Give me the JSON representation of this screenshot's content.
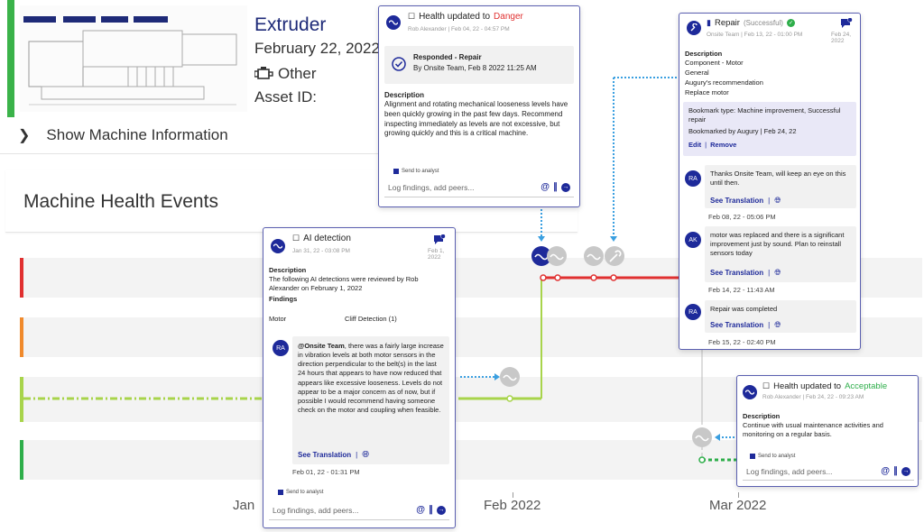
{
  "machine": {
    "name": "Extruder",
    "date": "February 22, 2022",
    "type": "Other",
    "asset_label": "Asset ID:",
    "show_info": "Show Machine Information"
  },
  "events": {
    "title": "Machine Health Events"
  },
  "timeline": {
    "labels": [
      "Jan",
      "Feb 2022",
      "Mar 2022"
    ]
  },
  "colors": {
    "danger": "#e03030",
    "acceptable": "#2eae4a",
    "warning": "#f08a2c",
    "caution": "#a8d44b",
    "brand": "#1e2a9a"
  },
  "popup_danger": {
    "title_prefix": "Health updated to",
    "status": "Danger",
    "meta": "Rob Alexander | Feb 04, 22 - 04:57 PM",
    "responded_title": "Responded - Repair",
    "responded_by": "By Onsite Team, Feb 8 2022 11:25 AM",
    "desc_label": "Description",
    "desc": "Alignment and rotating mechanical looseness levels have been quickly growing in the past few days. Recommend inspecting immediately as levels are not excessive, but growing quickly and this is a critical machine.",
    "send": "Send to analyst",
    "log_placeholder": "Log findings, add peers..."
  },
  "popup_ai": {
    "title": "AI detection",
    "meta": "Jan 31, 22 - 03:08 PM",
    "date_right": "Feb 1, 2022",
    "badge": "1",
    "desc_label": "Description",
    "desc": "The following AI detections were reviewed by Rob Alexander on February 1, 2022",
    "findings_label": "Findings",
    "finding_left": "Motor",
    "finding_right": "Cliff Detection (1)",
    "avatar": "RA",
    "comment_mention": "@Onsite Team",
    "comment_text": ", there was a fairly large increase in vibration levels at both motor sensors in the direction perpendicular to the belt(s) in the last 24 hours that appears to have now reduced that appears like excessive looseness. Levels do not appear to be a major concern as of now, but if possible I would recommend having someone check on the motor and coupling when feasible.",
    "see_translation": "See Translation",
    "comment_time": "Feb 01, 22 - 01:31 PM",
    "send": "Send to analyst",
    "log_placeholder": "Log findings, add peers..."
  },
  "popup_repair": {
    "title": "Repair",
    "status": "(Successful)",
    "meta": "Onsite Team | Feb 13, 22 - 01:00 PM",
    "date_right": "Feb 24, 2022",
    "badge": "4",
    "desc_label": "Description",
    "desc_lines": [
      "Component - Motor",
      "General",
      "Augury's recommendation",
      "Replace motor"
    ],
    "bookmark_type": "Bookmark type: Machine improvement, Successful repair",
    "bookmarked_by": "Bookmarked by Augury | Feb 24, 22",
    "edit": "Edit",
    "remove": "Remove",
    "comments": [
      {
        "avatar": "RA",
        "text": "Thanks Onsite Team, will keep an eye on this until then.",
        "see": "See Translation",
        "time": "Feb 08, 22 - 05:06 PM"
      },
      {
        "avatar": "AK",
        "text": "motor was replaced and there is a significant improvement just by sound.  Plan to reinstall sensors today",
        "see": "See Translation",
        "time": "Feb 14, 22 - 11:43 AM"
      },
      {
        "avatar": "RA",
        "text": "Repair was completed",
        "see": "See Translation",
        "time": "Feb 15, 22 - 02:40 PM"
      }
    ]
  },
  "popup_acceptable": {
    "title_prefix": "Health updated to",
    "status": "Acceptable",
    "meta": "Rob Alexander | Feb 24, 22 - 09:23 AM",
    "desc_label": "Description",
    "desc": "Continue with usual maintenance activities and monitoring on a regular basis.",
    "send": "Send to analyst",
    "log_placeholder": "Log findings, add peers..."
  }
}
